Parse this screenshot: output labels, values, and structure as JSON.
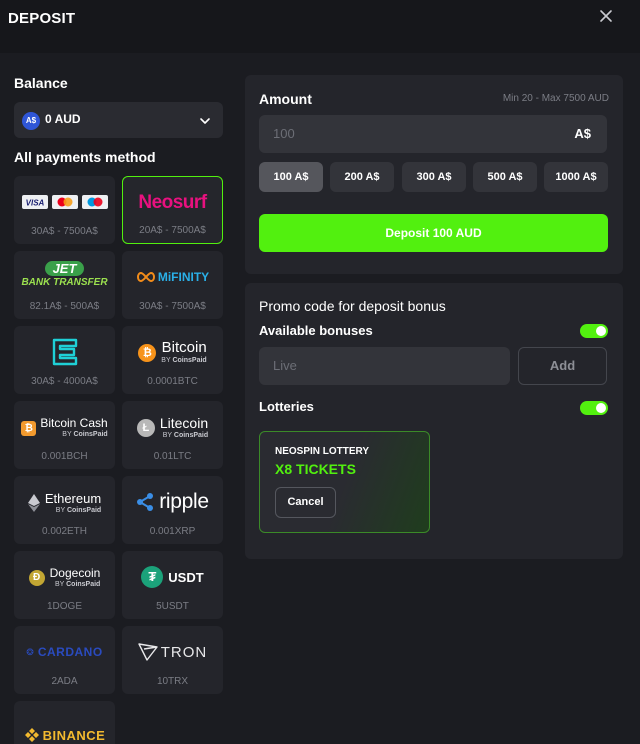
{
  "header": {
    "title": "DEPOSIT"
  },
  "balance": {
    "label": "Balance",
    "currency_badge": "A$",
    "value": "0 AUD"
  },
  "methods_label": "All payments method",
  "methods": [
    {
      "name": "visa-mastercard-maestro",
      "range": "30A$ - 7500A$"
    },
    {
      "name": "neosurf",
      "logo_text": "Neosurf",
      "range": "20A$ - 7500A$",
      "selected": true
    },
    {
      "name": "jet-bank-transfer",
      "logo_text_1": "JET",
      "logo_text_2": "BANK TRANSFER",
      "range": "82.1A$ - 500A$"
    },
    {
      "name": "mifinity",
      "logo_text": "MiFINITY",
      "range": "30A$ - 7500A$"
    },
    {
      "name": "e-wallet",
      "range": "30A$ - 4000A$"
    },
    {
      "name": "bitcoin",
      "logo_text": "Bitcoin",
      "range": "0.0001BTC"
    },
    {
      "name": "bitcoin-cash",
      "logo_text": "Bitcoin Cash",
      "range": "0.001BCH"
    },
    {
      "name": "litecoin",
      "logo_text": "Litecoin",
      "range": "0.01LTC"
    },
    {
      "name": "ethereum",
      "logo_text": "Ethereum",
      "range": "0.002ETH"
    },
    {
      "name": "ripple",
      "logo_text": "ripple",
      "range": "0.001XRP"
    },
    {
      "name": "dogecoin",
      "logo_text": "Dogecoin",
      "range": "1DOGE"
    },
    {
      "name": "usdt",
      "logo_text": "USDT",
      "range": "5USDT"
    },
    {
      "name": "cardano",
      "logo_text": "CARDANO",
      "range": "2ADA"
    },
    {
      "name": "tron",
      "logo_text": "TRON",
      "range": "10TRX"
    },
    {
      "name": "binance",
      "logo_text": "BINANCE",
      "range": ""
    }
  ],
  "coinspaid": {
    "by": "BY",
    "name": "CoinsPaid"
  },
  "amount": {
    "label": "Amount",
    "limits": "Min 20 - Max 7500 AUD",
    "placeholder": "100",
    "suffix": "A$",
    "chips": [
      "100 A$",
      "200 A$",
      "300 A$",
      "500 A$",
      "1000 A$"
    ],
    "active_chip": 0,
    "deposit_button": "Deposit 100 AUD"
  },
  "promo": {
    "title": "Promo code for deposit bonus",
    "bonuses_label": "Available bonuses",
    "bonuses_enabled": true,
    "input_placeholder": "Live",
    "add_button": "Add",
    "lotteries_label": "Lotteries",
    "lotteries_enabled": true,
    "lottery_card": {
      "title": "NEOSPIN LOTTERY",
      "tickets": "X8 TICKETS",
      "cancel": "Cancel"
    }
  },
  "colors": {
    "accent": "#52f00f",
    "background": "#1b1c21",
    "panel": "#24252b",
    "input": "#33343a"
  }
}
